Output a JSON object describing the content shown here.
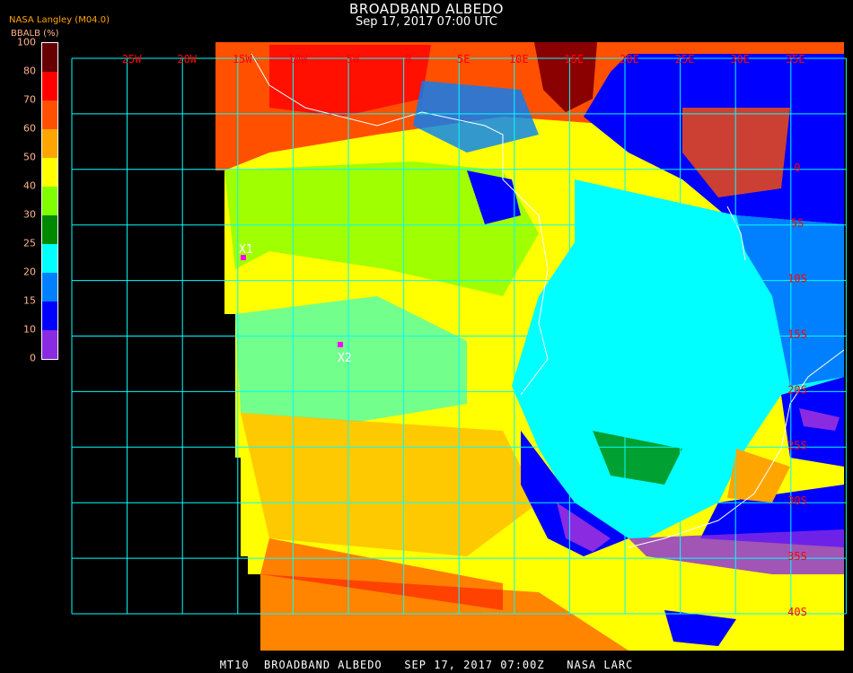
{
  "header": {
    "title": "BROADBAND ALBEDO",
    "subtitle": "Sep 17, 2017 07:00 UTC"
  },
  "legend": {
    "organization": "NASA Langley (M04.0)",
    "unit_label": "BBALB (%)",
    "ticks": [
      "0",
      "10",
      "15",
      "20",
      "25",
      "30",
      "40",
      "50",
      "60",
      "70",
      "80",
      "100"
    ],
    "colors": [
      "#8a2be2",
      "#0000ff",
      "#0080ff",
      "#00ffff",
      "#008800",
      "#80ff00",
      "#ffff00",
      "#ffa500",
      "#ff5000",
      "#ff0000",
      "#660000"
    ]
  },
  "map": {
    "longitude_labels": [
      "25W",
      "20W",
      "15W",
      "10W",
      "5W",
      "0",
      "5E",
      "10E",
      "15E",
      "20E",
      "25E",
      "30E",
      "35E"
    ],
    "latitude_labels": [
      "0",
      "5S",
      "10S",
      "15S",
      "20S",
      "25S",
      "30S",
      "35S",
      "40S"
    ],
    "grid_color": "#00ffff",
    "label_color": "#ff0000",
    "coastline_color": "#ffffff",
    "markers": [
      {
        "label": "X1",
        "color": "#ff00ff"
      },
      {
        "label": "X2",
        "color": "#ff00ff"
      }
    ]
  },
  "footer": {
    "text": "MT10  BROADBAND ALBEDO   SEP 17, 2017 07:00Z   NASA LARC"
  }
}
